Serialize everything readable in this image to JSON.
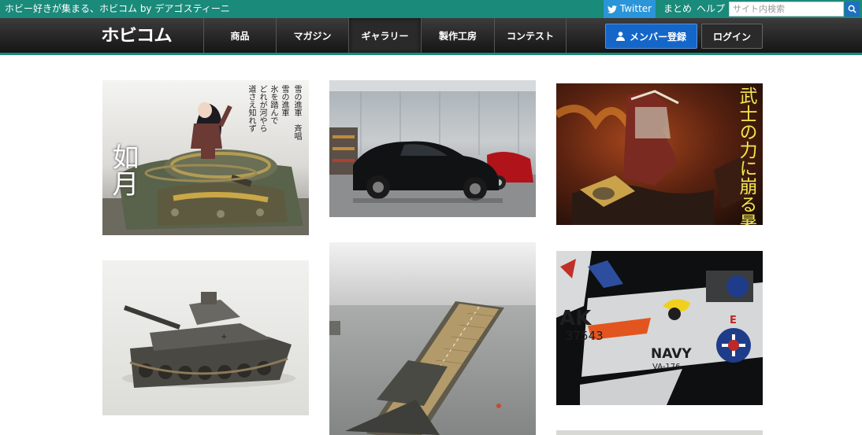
{
  "topbar": {
    "tagline": "ホビー好きが集まる、ホビコム by デアゴスティーニ",
    "twitter_label": "Twitter",
    "matome_label": "まとめ",
    "help_label": "ヘルプ",
    "search_placeholder": "サイト内検索"
  },
  "navbar": {
    "logo": "ホビコム",
    "items": [
      {
        "label": "商品"
      },
      {
        "label": "マガジン"
      },
      {
        "label": "ギャラリー"
      },
      {
        "label": "製作工房"
      },
      {
        "label": "コンテスト"
      }
    ],
    "active_item": "ギャラリー",
    "member_label": "メンバー登録",
    "login_label": "ログイン"
  },
  "gallery": {
    "tiles": [
      {
        "subject": "anime girl figure on tank diorama",
        "title_text": "如月",
        "poem_lines": [
          "雪の進軍　斉唱",
          "雪の進軍",
          "氷を踏んで",
          "どれが河やら",
          "道さえ知れず"
        ]
      },
      {
        "subject": "black sports car model in garage"
      },
      {
        "subject": "samurai armor diorama with fire",
        "title_text": "武士の力に崩る暑き夜"
      },
      {
        "subject": "weathered WWII tank model"
      },
      {
        "subject": "aircraft carrier ship model"
      },
      {
        "subject": "navy jet aircraft model",
        "aircraft_markings": [
          "AK",
          "37543",
          "NAVY",
          "VA-176",
          "E"
        ]
      }
    ]
  },
  "colors": {
    "topbar": "#1a8a7a",
    "twitter": "#2a95d8",
    "member_button": "#1466c9",
    "accent": "#1a8a7a"
  }
}
